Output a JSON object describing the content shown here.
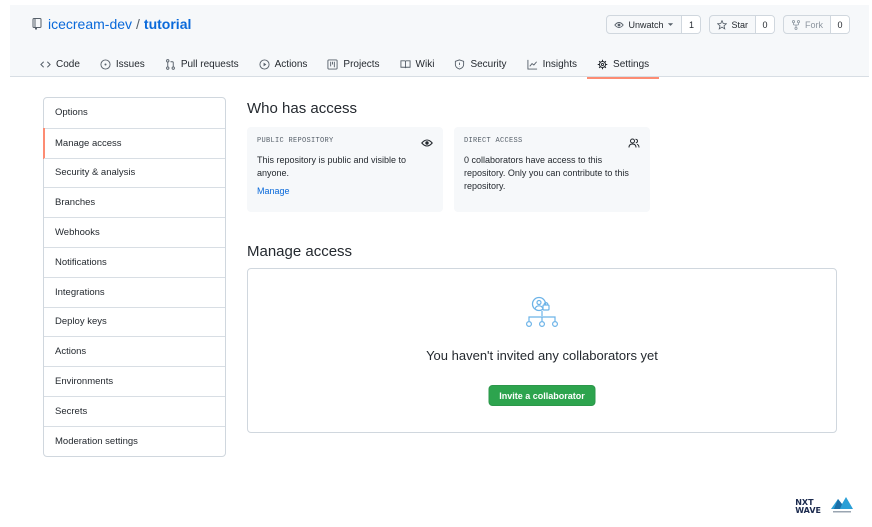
{
  "repo": {
    "owner": "icecream-dev",
    "slash": "/",
    "name": "tutorial"
  },
  "actions": [
    {
      "id": "watch",
      "label": "Unwatch",
      "count": "1",
      "icon": "eye-icon"
    },
    {
      "id": "star",
      "label": "Star",
      "count": "0",
      "icon": "star-icon"
    },
    {
      "id": "fork",
      "label": "Fork",
      "count": "0",
      "icon": "fork-icon"
    }
  ],
  "tabs": [
    {
      "label": "Code",
      "icon": "code-icon"
    },
    {
      "label": "Issues",
      "icon": "issue-icon"
    },
    {
      "label": "Pull requests",
      "icon": "pull-request-icon"
    },
    {
      "label": "Actions",
      "icon": "play-icon"
    },
    {
      "label": "Projects",
      "icon": "project-icon"
    },
    {
      "label": "Wiki",
      "icon": "book-icon"
    },
    {
      "label": "Security",
      "icon": "shield-icon"
    },
    {
      "label": "Insights",
      "icon": "graph-icon"
    },
    {
      "label": "Settings",
      "icon": "gear-icon"
    }
  ],
  "sidebar": {
    "items": [
      "Options",
      "Manage access",
      "Security & analysis",
      "Branches",
      "Webhooks",
      "Notifications",
      "Integrations",
      "Deploy keys",
      "Actions",
      "Environments",
      "Secrets",
      "Moderation settings"
    ]
  },
  "who": {
    "title": "Who has access",
    "public": {
      "eyebrow": "PUBLIC REPOSITORY",
      "body": "This repository is public and visible to anyone.",
      "link": "Manage"
    },
    "direct": {
      "eyebrow": "DIRECT ACCESS",
      "body": "0 collaborators have access to this repository. Only you can contribute to this repository."
    }
  },
  "manage": {
    "title": "Manage access",
    "empty_message": "You haven't invited any collaborators yet",
    "invite_label": "Invite a collaborator"
  },
  "watermark": {
    "line1": "NXT",
    "line2": "WAVE"
  },
  "colors": {
    "accent": "#fd8c73",
    "link": "#0969da",
    "primary": "#2da44e"
  }
}
